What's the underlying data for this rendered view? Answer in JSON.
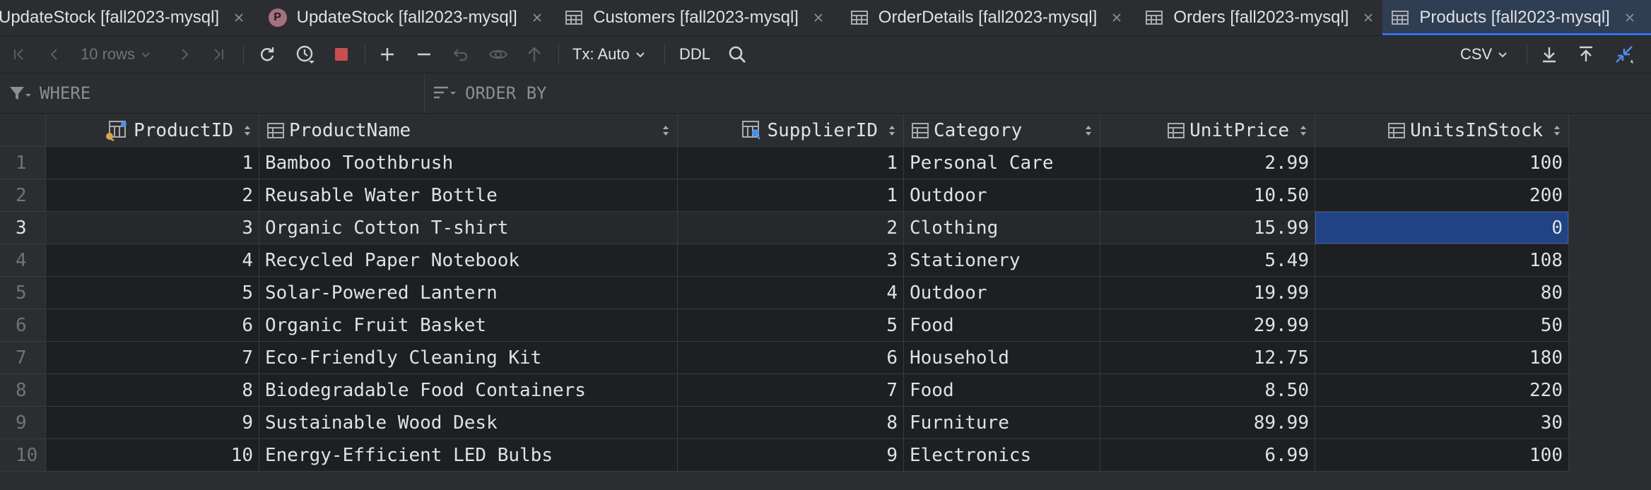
{
  "tabs": [
    {
      "label": "UpdateStock [fall2023-mysql]",
      "icon": "none",
      "active": false
    },
    {
      "label": "UpdateStock [fall2023-mysql]",
      "icon": "procedure-badge",
      "badge": "P",
      "active": false
    },
    {
      "label": "Customers [fall2023-mysql]",
      "icon": "table-icon",
      "active": false
    },
    {
      "label": "OrderDetails [fall2023-mysql]",
      "icon": "table-icon",
      "active": false
    },
    {
      "label": "Orders [fall2023-mysql]",
      "icon": "table-icon",
      "active": false
    },
    {
      "label": "Products [fall2023-mysql]",
      "icon": "table-icon",
      "active": true
    }
  ],
  "toolbar": {
    "rows_label": "10 rows",
    "tx_label": "Tx: Auto",
    "ddl_label": "DDL",
    "export_format": "CSV"
  },
  "filter": {
    "where_placeholder": "WHERE",
    "orderby_placeholder": "ORDER BY"
  },
  "grid": {
    "columns": [
      {
        "name": "ProductID",
        "icon": "key-column-icon"
      },
      {
        "name": "ProductName",
        "icon": "column-icon"
      },
      {
        "name": "SupplierID",
        "icon": "foreign-key-column-icon"
      },
      {
        "name": "Category",
        "icon": "column-icon"
      },
      {
        "name": "UnitPrice",
        "icon": "column-icon"
      },
      {
        "name": "UnitsInStock",
        "icon": "column-icon"
      }
    ],
    "rows": [
      {
        "n": "1",
        "id": "1",
        "name": "Bamboo Toothbrush",
        "sup": "1",
        "cat": "Personal Care",
        "price": "2.99",
        "stock": "100"
      },
      {
        "n": "2",
        "id": "2",
        "name": "Reusable Water Bottle",
        "sup": "1",
        "cat": "Outdoor",
        "price": "10.50",
        "stock": "200"
      },
      {
        "n": "3",
        "id": "3",
        "name": "Organic Cotton T-shirt",
        "sup": "2",
        "cat": "Clothing",
        "price": "15.99",
        "stock": "0"
      },
      {
        "n": "4",
        "id": "4",
        "name": "Recycled Paper Notebook",
        "sup": "3",
        "cat": "Stationery",
        "price": "5.49",
        "stock": "108"
      },
      {
        "n": "5",
        "id": "5",
        "name": "Solar-Powered Lantern",
        "sup": "4",
        "cat": "Outdoor",
        "price": "19.99",
        "stock": "80"
      },
      {
        "n": "6",
        "id": "6",
        "name": "Organic Fruit Basket",
        "sup": "5",
        "cat": "Food",
        "price": "29.99",
        "stock": "50"
      },
      {
        "n": "7",
        "id": "7",
        "name": "Eco-Friendly Cleaning Kit",
        "sup": "6",
        "cat": "Household",
        "price": "12.75",
        "stock": "180"
      },
      {
        "n": "8",
        "id": "8",
        "name": "Biodegradable Food Containers",
        "sup": "7",
        "cat": "Food",
        "price": "8.50",
        "stock": "220"
      },
      {
        "n": "9",
        "id": "9",
        "name": "Sustainable Wood Desk",
        "sup": "8",
        "cat": "Furniture",
        "price": "89.99",
        "stock": "30"
      },
      {
        "n": "10",
        "id": "10",
        "name": "Energy-Efficient LED Bulbs",
        "sup": "9",
        "cat": "Electronics",
        "price": "6.99",
        "stock": "100"
      }
    ],
    "current_row": 2,
    "selected_cell": "UnitsInStock"
  },
  "colors": {
    "background": "#1e1f22",
    "panel": "#2b2d30",
    "accent": "#3574f0",
    "selection": "#214283",
    "stop": "#c94f4f"
  }
}
